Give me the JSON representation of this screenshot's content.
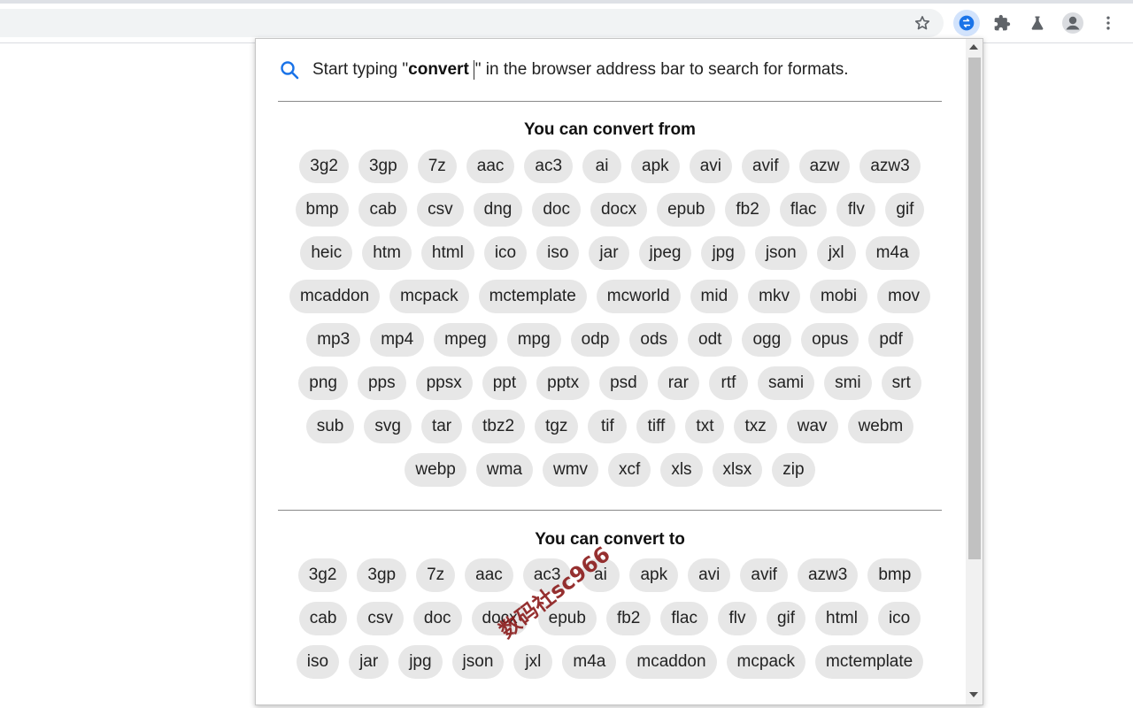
{
  "browser": {
    "toolbar_icons": [
      "star-icon",
      "converter-extension-icon",
      "puzzle-icon",
      "flask-icon",
      "profile-icon",
      "kebab-menu-icon"
    ],
    "accent_color": "#1a73e8"
  },
  "popup": {
    "hint_prefix": "Start typing \"",
    "hint_keyword": "convert",
    "hint_suffix": "\" in the browser address bar to search for formats.",
    "from_title": "You can convert from",
    "from_formats": [
      "3g2",
      "3gp",
      "7z",
      "aac",
      "ac3",
      "ai",
      "apk",
      "avi",
      "avif",
      "azw",
      "azw3",
      "bmp",
      "cab",
      "csv",
      "dng",
      "doc",
      "docx",
      "epub",
      "fb2",
      "flac",
      "flv",
      "gif",
      "heic",
      "htm",
      "html",
      "ico",
      "iso",
      "jar",
      "jpeg",
      "jpg",
      "json",
      "jxl",
      "m4a",
      "mcaddon",
      "mcpack",
      "mctemplate",
      "mcworld",
      "mid",
      "mkv",
      "mobi",
      "mov",
      "mp3",
      "mp4",
      "mpeg",
      "mpg",
      "odp",
      "ods",
      "odt",
      "ogg",
      "opus",
      "pdf",
      "png",
      "pps",
      "ppsx",
      "ppt",
      "pptx",
      "psd",
      "rar",
      "rtf",
      "sami",
      "smi",
      "srt",
      "sub",
      "svg",
      "tar",
      "tbz2",
      "tgz",
      "tif",
      "tiff",
      "txt",
      "txz",
      "wav",
      "webm",
      "webp",
      "wma",
      "wmv",
      "xcf",
      "xls",
      "xlsx",
      "zip"
    ],
    "to_title": "You can convert to",
    "to_formats": [
      "3g2",
      "3gp",
      "7z",
      "aac",
      "ac3",
      "ai",
      "apk",
      "avi",
      "avif",
      "azw3",
      "bmp",
      "cab",
      "csv",
      "doc",
      "docx",
      "epub",
      "fb2",
      "flac",
      "flv",
      "gif",
      "html",
      "ico",
      "iso",
      "jar",
      "jpg",
      "json",
      "jxl",
      "m4a",
      "mcaddon",
      "mcpack",
      "mctemplate"
    ]
  },
  "watermark": "数码社sc966"
}
